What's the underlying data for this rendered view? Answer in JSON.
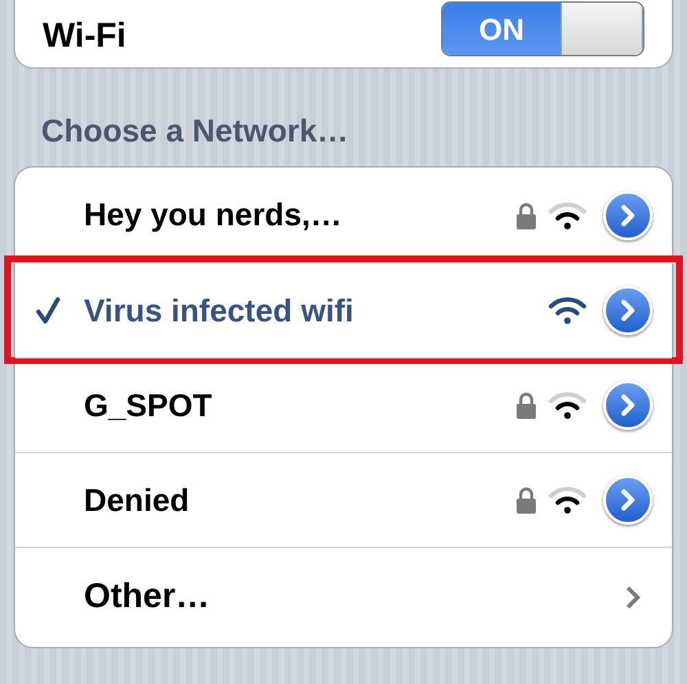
{
  "wifi_row": {
    "label": "Wi-Fi",
    "toggle": {
      "label": "ON",
      "on": true
    }
  },
  "section_title": "Choose a Network…",
  "networks": [
    {
      "kind": "network",
      "name": "Hey you nerds,…",
      "selected": false,
      "locked": true,
      "highlighted": false
    },
    {
      "kind": "network",
      "name": "Virus infected wifi",
      "selected": true,
      "locked": false,
      "highlighted": true
    },
    {
      "kind": "network",
      "name": "G_SPOT",
      "selected": false,
      "locked": true,
      "highlighted": false
    },
    {
      "kind": "network",
      "name": "Denied",
      "selected": false,
      "locked": true,
      "highlighted": false
    },
    {
      "kind": "other",
      "name": "Other…"
    }
  ]
}
